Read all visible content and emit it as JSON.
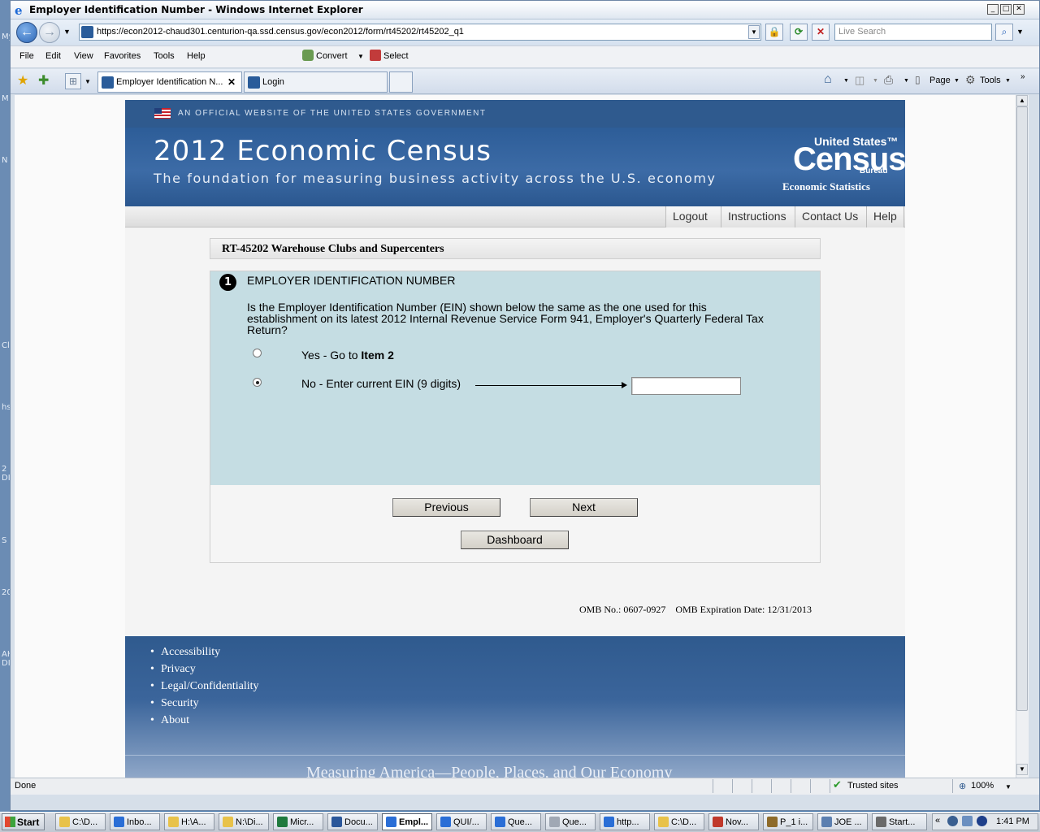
{
  "window": {
    "title": "Employer Identification Number - Windows Internet Explorer"
  },
  "address": {
    "url": "https://econ2012-chaud301.centurion-qa.ssd.census.gov/econ2012/form/rt45202/rt45202_q1",
    "search_placeholder": "Live Search"
  },
  "menu": {
    "items": [
      "File",
      "Edit",
      "View",
      "Favorites",
      "Tools",
      "Help"
    ],
    "convert": "Convert",
    "select": "Select"
  },
  "tabs": [
    {
      "label": "Employer Identification N..."
    },
    {
      "label": "Login"
    }
  ],
  "commandbar": {
    "page": "Page",
    "tools": "Tools"
  },
  "site": {
    "gov_banner": "AN OFFICIAL WEBSITE OF THE UNITED STATES GOVERNMENT",
    "title": "2012 Economic Census",
    "subtitle": "The foundation for measuring business activity across the U.S. economy",
    "logo": {
      "line1": "United States™",
      "line2": "Census",
      "line3": "Bureau",
      "line4": "Economic Statistics"
    },
    "top_links": [
      "Logout",
      "Instructions",
      "Contact Us",
      "Help"
    ]
  },
  "form": {
    "title": "RT-45202 Warehouse Clubs and Supercenters",
    "item_number": "1",
    "heading": "EMPLOYER IDENTIFICATION NUMBER",
    "question": "Is the Employer Identification Number (EIN) shown below the same as the one used for this establishment on its latest 2012 Internal Revenue Service Form 941, Employer's Quarterly Federal Tax Return?",
    "option_yes": "Yes - Go to ",
    "option_yes_bold": "Item 2",
    "option_no": "No - Enter current EIN (9 digits)",
    "selected": "no",
    "ein_value": "",
    "buttons": {
      "previous": "Previous",
      "next": "Next",
      "dashboard": "Dashboard"
    }
  },
  "omb": {
    "number": "OMB No.: 0607-0927",
    "expiration": "OMB Expiration Date: 12/31/2013"
  },
  "footer": {
    "links": [
      "Accessibility",
      "Privacy",
      "Legal/Confidentiality",
      "Security",
      "About"
    ],
    "tagline": "Measuring America—People, Places, and Our Economy"
  },
  "status": {
    "text": "Done",
    "zone": "Trusted sites",
    "zoom": "100%"
  },
  "taskbar": {
    "start": "Start",
    "items": [
      "C:\\D...",
      "Inbo...",
      "H:\\A...",
      "N:\\Di...",
      "Micr...",
      "Docu...",
      "Empl...",
      "QUI/...",
      "Que...",
      "Que...",
      "http...",
      "C:\\D...",
      "Nov...",
      "P_1 i...",
      "JOE ...",
      "Start..."
    ],
    "clock": "1:41 PM"
  },
  "desktop_labels": [
    "My",
    "M",
    "N",
    "Cl",
    "hs",
    "2\nDI",
    "S",
    "20",
    "AH\nDI"
  ],
  "colors": {
    "banner": "#2f5a8e",
    "question_panel": "#c5dde3",
    "footer": "#2f5a8e"
  }
}
